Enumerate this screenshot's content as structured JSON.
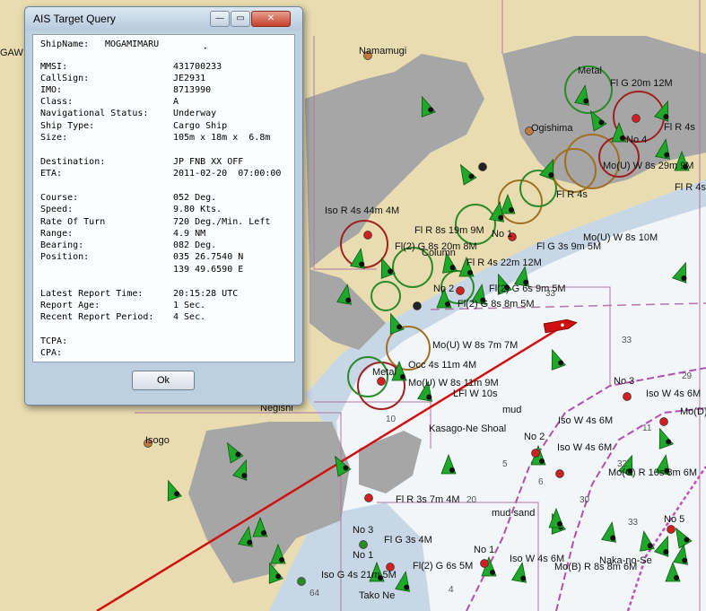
{
  "window": {
    "title": "AIS Target Query",
    "controls": {
      "minimize": "—",
      "maximize": "▭",
      "close": "✕"
    }
  },
  "ship": {
    "name_label": "ShipName:",
    "name": "MOGAMIMARU",
    "fields": [
      {
        "label": "MMSI:",
        "value": "431700233"
      },
      {
        "label": "CallSign:",
        "value": "JE2931"
      },
      {
        "label": "IMO:",
        "value": "8713990"
      },
      {
        "label": "Class:",
        "value": "A"
      },
      {
        "label": "Navigational Status:",
        "value": "Underway"
      },
      {
        "label": "Ship Type:",
        "value": "Cargo Ship"
      },
      {
        "label": "Size:",
        "value": "105m x 18m x  6.8m"
      },
      {
        "label": "Destination:",
        "value": "JP FNB XX OFF"
      },
      {
        "label": "ETA:",
        "value": "2011-02-20  07:00:00"
      },
      {
        "label": "Course:",
        "value": "052 Deg."
      },
      {
        "label": "Speed:",
        "value": "9.80 Kts."
      },
      {
        "label": "Rate Of Turn",
        "value": "720 Deg./Min. Left"
      },
      {
        "label": "Range:",
        "value": "4.9 NM"
      },
      {
        "label": "Bearing:",
        "value": "082 Deg."
      },
      {
        "label": "Position:",
        "value": "035 26.7540 N"
      },
      {
        "label": "",
        "value": "139 49.6590 E"
      },
      {
        "label": "Latest Report Time:",
        "value": "20:15:28 UTC"
      },
      {
        "label": "Report Age:",
        "value": "1 Sec."
      },
      {
        "label": "Recent Report Period:",
        "value": "4 Sec."
      },
      {
        "label": "TCPA:",
        "value": ""
      },
      {
        "label": "CPA:",
        "value": ""
      }
    ]
  },
  "ok_label": "Ok",
  "map": {
    "labels": [
      "GAW",
      "Namamugi",
      "Metal",
      "Fl G 20m 12M",
      "Ogishima",
      "No 4",
      "Fl R 4s",
      "Mo(U) W 8s 29m 9M",
      "Fl R 4s",
      "Iso R 4s 44m 4M",
      "Fl(2) G 8s 20m 8M",
      "Fl R 8s 19m 9M",
      "No 1",
      "Fl G 3s 9m 5M",
      "Mo(U) W 8s 10M",
      "Column",
      "Fl R 4s 22m 12M",
      "Fl(2) G 6s 9m 5M",
      "No 2",
      "Fl(2) G 8s 8m 5M",
      "Mo(U) W 8s 7m 7M",
      "Iso W 4s 6M",
      "Occ 4s 11m 4M",
      "Metal",
      "Mo(U) W 8s 11m 9M",
      "LFl W 10s",
      "mud",
      "No 3",
      "Iso W 4s 6M",
      "Mo(D)",
      "Negishi",
      "Isogo",
      "Kasago-Ne Shoal",
      "No 2",
      "Iso W 4s 6M",
      "Mo(C) R 10s 8m 6M",
      "Fl R 3s 7m 4M",
      "mud sand",
      "No 5",
      "No 3",
      "Fl G 3s 4M",
      "No 1",
      "No 1",
      "Fl(2) G 6s 5M",
      "Iso G 4s 21m 5M",
      "Iso W 4s 6M",
      "Mo(B) R 8s 8m 6M",
      "Naka-no-Se",
      "Tako Ne",
      "Fl R 4s"
    ],
    "depths": [
      "33",
      "33",
      "29",
      "11",
      "32",
      "33",
      "30",
      "20",
      "10",
      "5",
      "6",
      "64",
      "4"
    ],
    "colors": {
      "land": "#e8dcb0",
      "built": "#a6a6a6",
      "shallow": "#c7d7e6",
      "sea": "#f2f6f9",
      "route": "#d01010",
      "channel": "#b050b0",
      "buoy_green": "#1fa82a",
      "boundary": "#b276a6"
    },
    "icons": [
      "own-ship-icon",
      "buoy-icon",
      "light-icon",
      "ais-target-icon"
    ]
  }
}
